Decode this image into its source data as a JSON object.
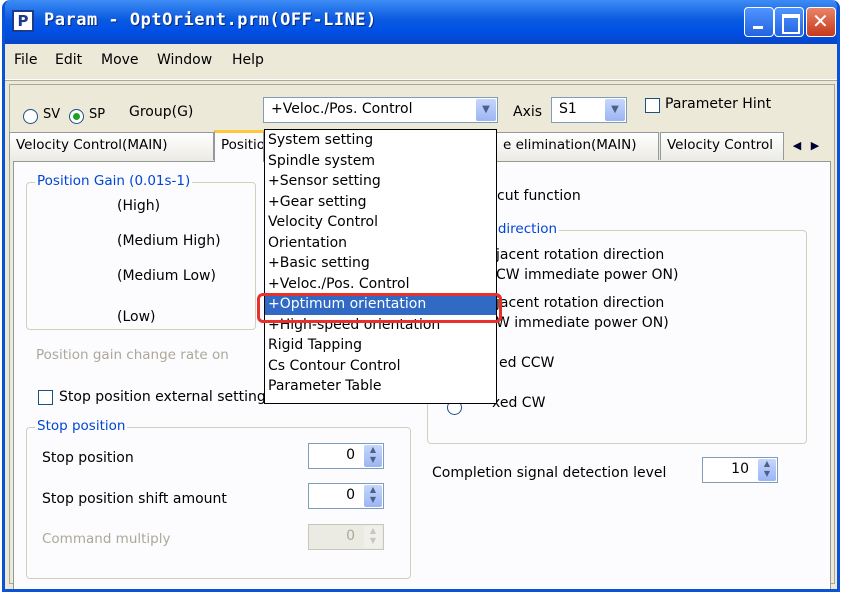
{
  "window": {
    "icon_letter": "P",
    "title": "Param - OptOrient.prm(OFF-LINE)"
  },
  "menu": [
    "File",
    "Edit",
    "Move",
    "Window",
    "Help"
  ],
  "toolbar": {
    "sv_label": "SV",
    "sp_label": "SP",
    "selected_mode": "SP",
    "group_label": "Group(G)",
    "group_value": "+Veloc./Pos. Control",
    "axis_label": "Axis",
    "axis_value": "S1",
    "hint_label": "Parameter Hint",
    "hint_checked": false
  },
  "tabs": [
    {
      "label": "Velocity Control(MAIN)",
      "active": false
    },
    {
      "label": "Position",
      "active": true
    },
    {
      "label": "e elimination(MAIN)",
      "active": false
    },
    {
      "label": "Velocity Control",
      "active": false
    }
  ],
  "dropdown": {
    "items": [
      "System setting",
      "Spindle system",
      " +Sensor setting",
      " +Gear setting",
      "Velocity Control",
      "Orientation",
      " +Basic setting",
      " +Veloc./Pos. Control",
      " +Optimum orientation",
      " +High-speed orientation",
      "Rigid Tapping",
      "Cs Contour Control",
      "Parameter Table"
    ],
    "selected_index": 8
  },
  "left_panel": {
    "position_gain_title": "Position Gain (0.01s-1)",
    "gain_labels": [
      "(High)",
      "(Medium High)",
      "(Medium Low)",
      "(Low)"
    ],
    "change_rate_label": "Position gain change rate on",
    "stop_external_label": "Stop position external setting",
    "stop_group_title": "Stop position",
    "stop_position_label": "Stop position",
    "stop_position_value": "0",
    "shift_amount_label": "Stop position shift amount",
    "shift_amount_value": "0",
    "command_multiply_label": "Command multiply",
    "command_multiply_value": "0"
  },
  "right_panel": {
    "shortcut_label": "cut function",
    "direction_title": "n direction",
    "dir_options": [
      "jacent rotation direction",
      "CW immediate power ON)",
      "jacent rotation direction",
      "W immediate power ON)",
      "ed CCW",
      "xed CW"
    ],
    "completion_label": "Completion signal detection level",
    "completion_value": "10"
  }
}
